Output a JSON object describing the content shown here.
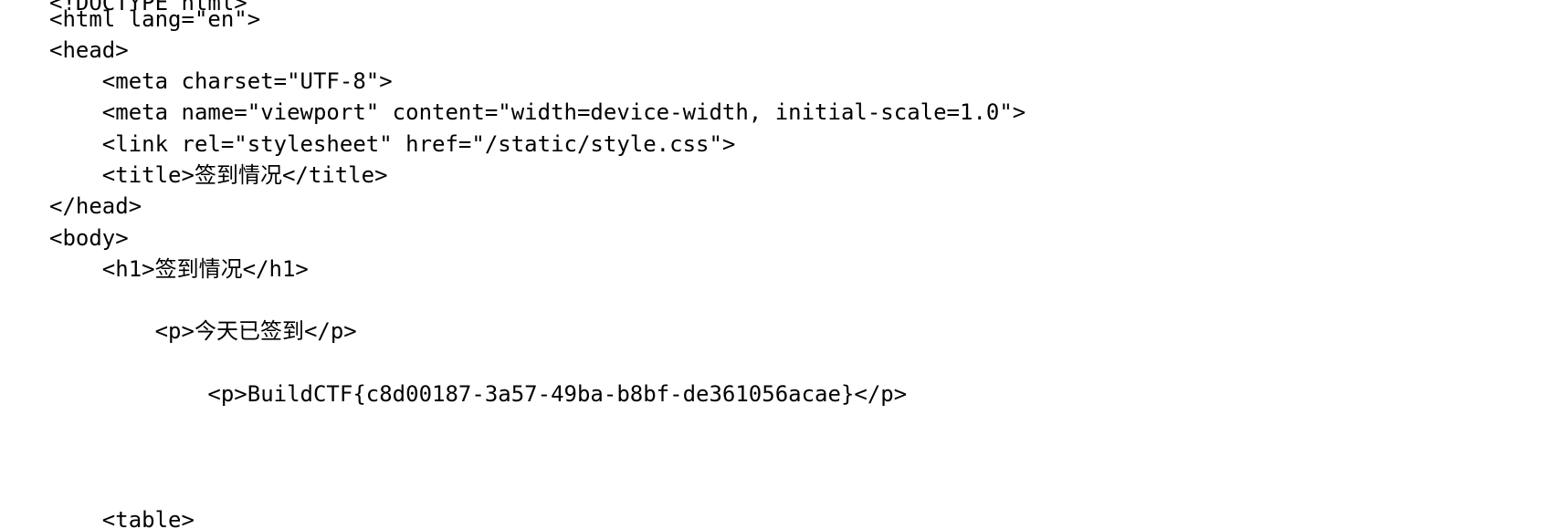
{
  "source_view": {
    "lines": [
      "<!DOCTYPE html>",
      "<html lang=\"en\">",
      "<head>",
      "    <meta charset=\"UTF-8\">",
      "    <meta name=\"viewport\" content=\"width=device-width, initial-scale=1.0\">",
      "    <link rel=\"stylesheet\" href=\"/static/style.css\">",
      "    <title>签到情况</title>",
      "</head>",
      "<body>",
      "    <h1>签到情况</h1>",
      "",
      "        <p>今天已签到</p>",
      "",
      "            <p>BuildCTF{c8d00187-3a57-49ba-b8bf-de361056acae}</p>",
      "",
      "",
      "",
      "    <table>"
    ]
  }
}
